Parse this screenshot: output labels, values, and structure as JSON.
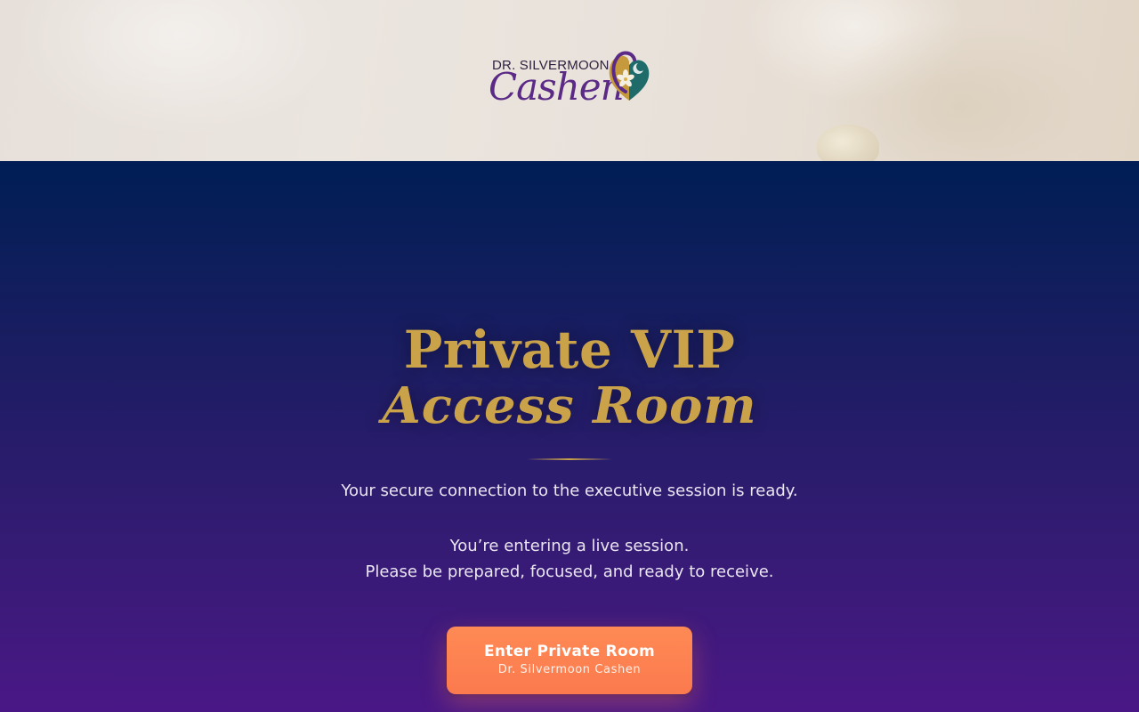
{
  "header": {
    "logo": {
      "top_text": "DR. SILVERMOON",
      "script_text": "Cashen",
      "icon": "heart-flower-logo-icon"
    }
  },
  "hero": {
    "title_line1": "Private VIP",
    "title_line2": "Access Room",
    "tagline": "Your secure connection to the executive session is ready.",
    "message_line1": "You’re entering a live session.",
    "message_line2": "Please be prepared, focused, and ready to receive."
  },
  "cta": {
    "label": "Enter Private Room",
    "sublabel": "Dr. Silvermoon Cashen"
  },
  "colors": {
    "gold": "#c9a24a",
    "cta": "#fb7a4e",
    "navy_top": "#001e55",
    "purple_bottom": "#4a1886",
    "logo_purple": "#5a2a86"
  }
}
